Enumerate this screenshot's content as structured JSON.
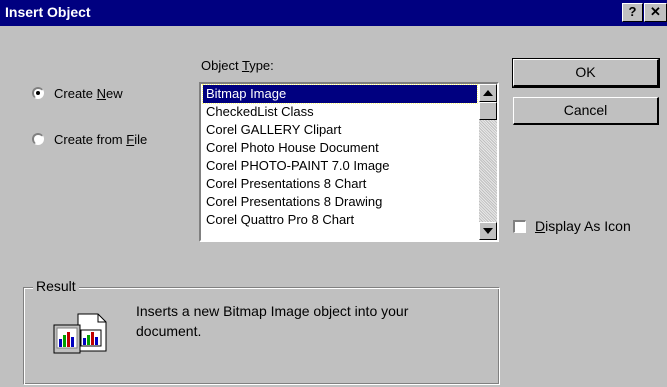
{
  "window": {
    "title": "Insert Object",
    "help_label": "?",
    "close_label": "✕"
  },
  "options": {
    "create_new_pre": "Create ",
    "create_new_u": "N",
    "create_new_post": "ew",
    "create_from_file_pre": "Create from ",
    "create_from_file_u": "F",
    "create_from_file_post": "ile",
    "selected": "create_new"
  },
  "object_type": {
    "label_pre": "Object ",
    "label_u": "T",
    "label_post": "ype:",
    "items": [
      "Bitmap Image",
      "CheckedList Class",
      "Corel GALLERY Clipart",
      "Corel Photo House Document",
      "Corel PHOTO-PAINT 7.0 Image",
      "Corel Presentations 8 Chart",
      "Corel Presentations 8 Drawing",
      "Corel Quattro Pro 8 Chart"
    ],
    "selected_index": 0
  },
  "buttons": {
    "ok": "OK",
    "cancel": "Cancel"
  },
  "display_as_icon": {
    "pre": "",
    "u": "D",
    "post": "isplay As Icon",
    "checked": false
  },
  "result": {
    "legend": "Result",
    "text": "Inserts a new Bitmap Image object into your document.",
    "icon": "bitmap-object-icon"
  },
  "colors": {
    "titlebar": "#000080",
    "face": "#c0c0c0",
    "selection": "#000080"
  }
}
